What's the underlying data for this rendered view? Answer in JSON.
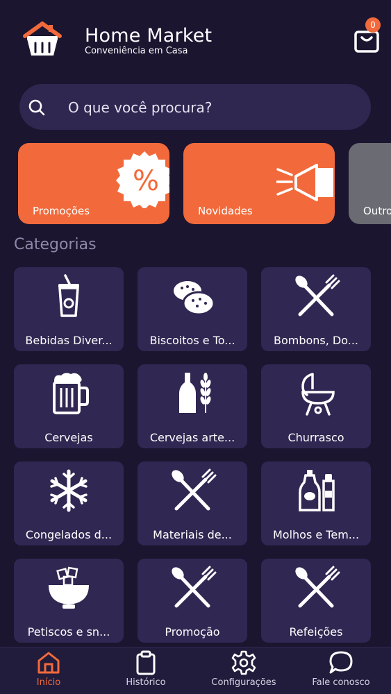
{
  "header": {
    "title": "Home Market",
    "subtitle": "Conveniência em Casa",
    "cart_count": "0",
    "logo_icon": "basket-house-icon",
    "cart_icon": "shopping-bag-icon"
  },
  "search": {
    "placeholder": "O que você procura?",
    "icon": "search-icon"
  },
  "promos": [
    {
      "label": "Promoções",
      "icon": "percent-badge-icon",
      "color": "#f26a3b"
    },
    {
      "label": "Novidades",
      "icon": "megaphone-icon",
      "color": "#f26a3b"
    },
    {
      "label": "Outros",
      "icon": "",
      "color": "#6b6b73"
    }
  ],
  "categories_title": "Categorias",
  "categories": [
    {
      "label": "Bebidas Diver...",
      "icon": "soda-cup-icon"
    },
    {
      "label": "Biscoitos e To...",
      "icon": "biscuits-icon"
    },
    {
      "label": "Bombons, Do...",
      "icon": "fork-spoon-icon"
    },
    {
      "label": "Cervejas",
      "icon": "beer-mug-icon"
    },
    {
      "label": "Cervejas arte...",
      "icon": "beer-bottle-wheat-icon"
    },
    {
      "label": "Churrasco",
      "icon": "grill-icon"
    },
    {
      "label": "Congelados d...",
      "icon": "snowflake-icon"
    },
    {
      "label": "Materiais de...",
      "icon": "fork-spoon-icon"
    },
    {
      "label": "Molhos e Tem...",
      "icon": "sauce-bottles-icon"
    },
    {
      "label": "Petiscos e sn...",
      "icon": "snack-bowl-icon"
    },
    {
      "label": "Promoção",
      "icon": "fork-spoon-icon"
    },
    {
      "label": "Refeições",
      "icon": "fork-spoon-icon"
    }
  ],
  "nav": [
    {
      "label": "Início",
      "icon": "home-icon",
      "active": true
    },
    {
      "label": "Histórico",
      "icon": "clipboard-icon",
      "active": false
    },
    {
      "label": "Configurações",
      "icon": "gear-icon",
      "active": false
    },
    {
      "label": "Fale conosco",
      "icon": "chat-bubble-icon",
      "active": false
    }
  ],
  "colors": {
    "background": "#1b1530",
    "tile": "#302752",
    "accent": "#f26a3b",
    "search": "#2f2750"
  }
}
